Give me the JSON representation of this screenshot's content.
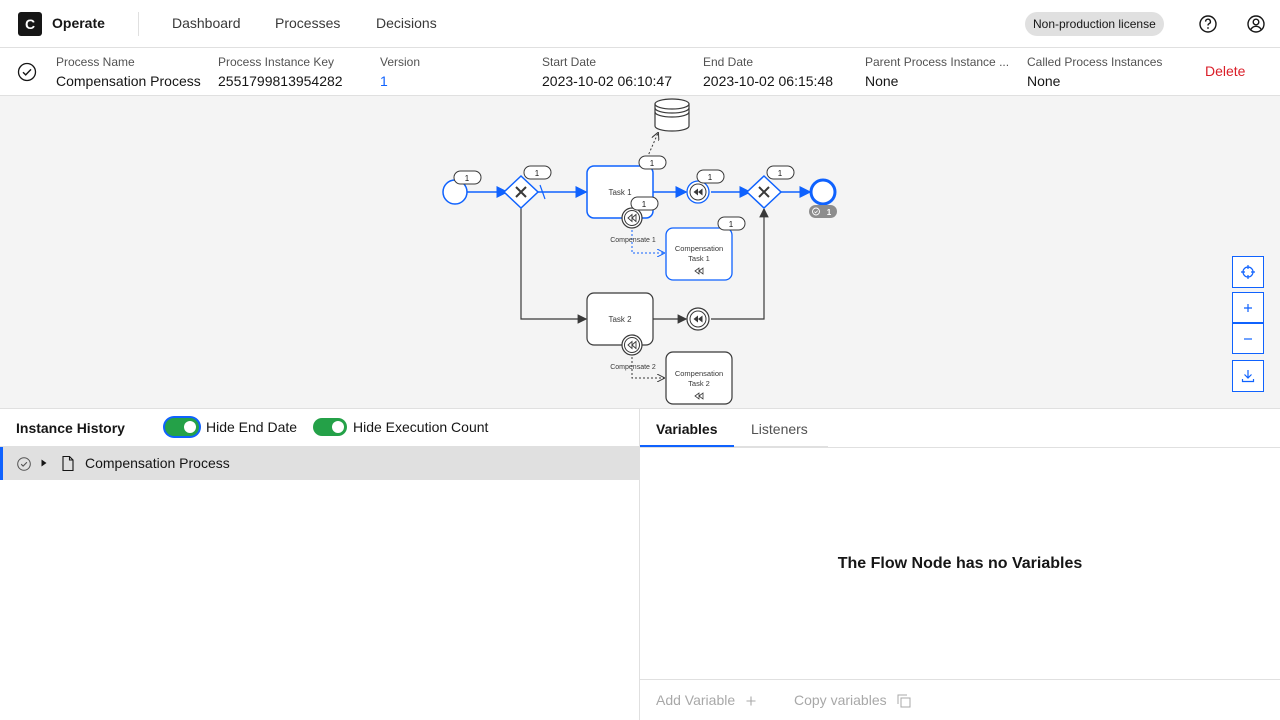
{
  "header": {
    "logo_letter": "C",
    "app_name": "Operate",
    "nav": [
      "Dashboard",
      "Processes",
      "Decisions"
    ],
    "license": "Non-production license"
  },
  "instance": {
    "process_name": {
      "label": "Process Name",
      "value": "Compensation Process"
    },
    "instance_key": {
      "label": "Process Instance Key",
      "value": "2551799813954282"
    },
    "version": {
      "label": "Version",
      "value": "1"
    },
    "start_date": {
      "label": "Start Date",
      "value": "2023-10-02 06:10:47"
    },
    "end_date": {
      "label": "End Date",
      "value": "2023-10-02 06:15:48"
    },
    "parent": {
      "label": "Parent Process Instance ...",
      "value": "None"
    },
    "called": {
      "label": "Called Process Instances",
      "value": "None"
    },
    "delete_label": "Delete"
  },
  "diagram": {
    "tasks": {
      "task1": "Task 1",
      "task2": "Task 2",
      "comp1_line1": "Compensation",
      "comp1_line2": "Task 1",
      "comp2_line1": "Compensation",
      "comp2_line2": "Task 2"
    },
    "labels": {
      "compensate1": "Compensate 1",
      "compensate2": "Compensate 2"
    },
    "counts": {
      "start": "1",
      "gateway1": "1",
      "task1": "1",
      "boundary1": "1",
      "throw1": "1",
      "gateway2": "1",
      "comp_task1": "1",
      "end": "1"
    }
  },
  "history": {
    "title": "Instance History",
    "toggle_end_date": "Hide End Date",
    "toggle_exec_count": "Hide Execution Count",
    "root_node": "Compensation Process"
  },
  "variables": {
    "tabs": [
      "Variables",
      "Listeners"
    ],
    "empty_message": "The Flow Node has no Variables",
    "add_variable": "Add Variable",
    "copy_variables": "Copy variables"
  },
  "colors": {
    "accent": "#0f62fe",
    "danger": "#da1e28",
    "success": "#24a148",
    "diagram_bg": "#f4f4f4"
  }
}
